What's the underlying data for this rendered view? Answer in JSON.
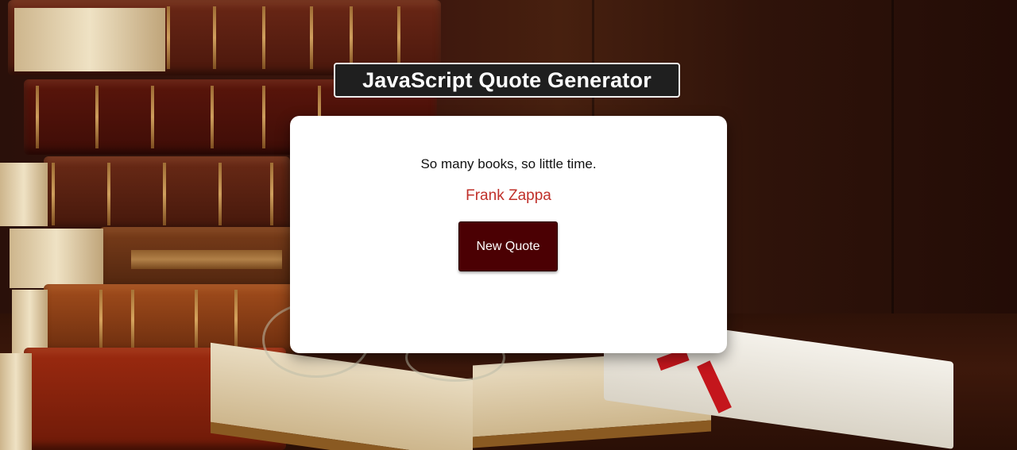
{
  "header": {
    "title": "JavaScript Quote Generator"
  },
  "quote_card": {
    "quote": "So many books, so little time.",
    "author": "Frank Zappa",
    "new_quote_label": "New Quote"
  },
  "colors": {
    "title_bg": "#1f1f1f",
    "author_text": "#c0302a",
    "button_bg": "#4b0003",
    "card_bg": "#ffffff"
  },
  "background": {
    "subject": "antique-books-photo"
  }
}
